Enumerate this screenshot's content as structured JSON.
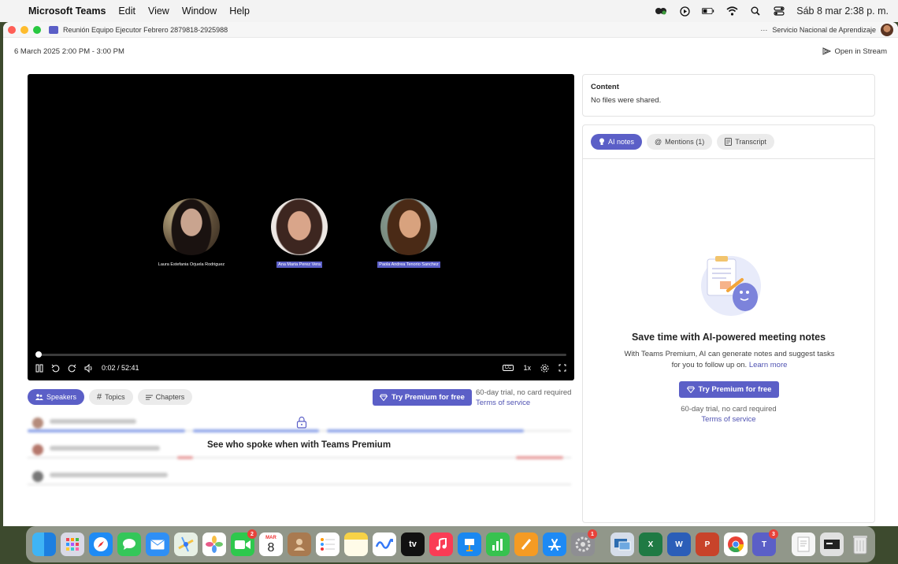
{
  "menubar": {
    "app_name": "Microsoft Teams",
    "items": [
      "Edit",
      "View",
      "Window",
      "Help"
    ],
    "clock": "Sáb 8 mar 2:38 p. m."
  },
  "window": {
    "title": "Reunión Equipo Ejecutor Febrero 2879818-2925988",
    "org": "Servicio Nacional de Aprendizaje",
    "more": "···"
  },
  "recording": {
    "date_range": "6 March 2025 2:00 PM - 3:00 PM",
    "open_in_stream": "Open in Stream"
  },
  "video": {
    "participants": [
      {
        "name": "Laura Estefania Orjuela Rodriguez",
        "highlighted": false
      },
      {
        "name": "Ana Maria Perez Vera",
        "highlighted": true
      },
      {
        "name": "Paola Andrea Tenorio Sanchez",
        "highlighted": true
      }
    ],
    "time": "0:02 / 52:41",
    "speed": "1x"
  },
  "tabs": {
    "speakers": "Speakers",
    "topics": "Topics",
    "chapters": "Chapters"
  },
  "premium": {
    "button": "Try Premium for free",
    "trial": "60-day trial, no card required",
    "terms": "Terms of service",
    "see_who": "See who spoke when with Teams Premium"
  },
  "content": {
    "title": "Content",
    "empty": "No files were shared."
  },
  "notes": {
    "tabs": [
      "AI notes",
      "Mentions (1)",
      "Transcript"
    ],
    "title": "Save time with AI-powered meeting notes",
    "desc": "With Teams Premium, AI can generate notes and suggest tasks for you to follow up on.",
    "learn_more": "Learn more",
    "button": "Try Premium for free",
    "trial": "60-day trial, no card required",
    "terms": "Terms of service"
  },
  "dock": {
    "calendar_month": "MAR",
    "calendar_day": "8",
    "badges": {
      "facetime": "2",
      "system_settings": "1",
      "teams": "3"
    },
    "tv_label": "tv"
  },
  "colors": {
    "accent": "#5b5fc7",
    "link": "#4f52b2"
  }
}
